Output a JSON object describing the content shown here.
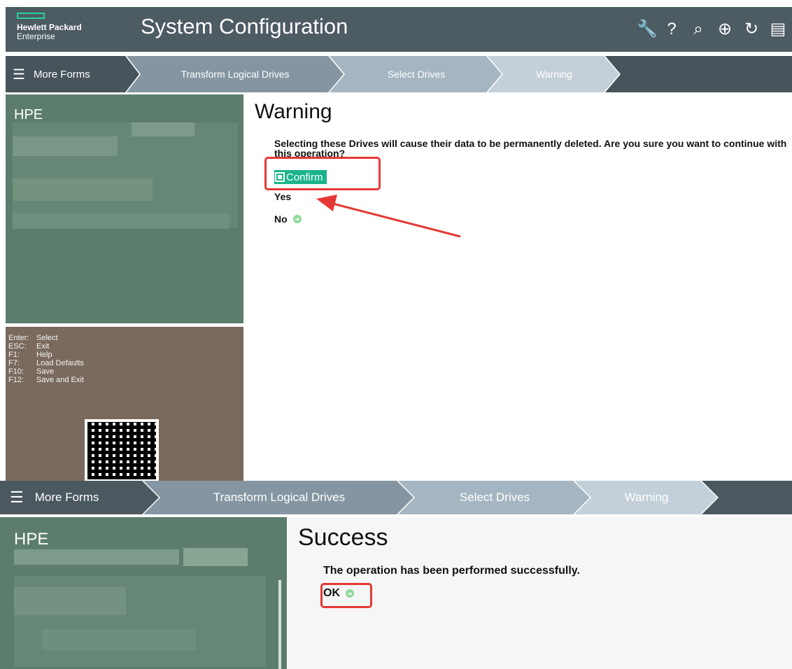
{
  "header": {
    "logo_line1": "Hewlett Packard",
    "logo_line2": "Enterprise",
    "title": "System Configuration",
    "icons": [
      "wrench-icon",
      "help-icon",
      "search-icon",
      "globe-icon",
      "refresh-icon",
      "storage-icon"
    ],
    "icon_glyphs": [
      "🔧",
      "?",
      "⌕",
      "⊕",
      "↻",
      "▤"
    ]
  },
  "breadcrumb": {
    "more_forms": "More Forms",
    "items": [
      "Transform Logical Drives",
      "Select Drives",
      "Warning"
    ]
  },
  "left_panel": {
    "brand": "HPE"
  },
  "keys": [
    {
      "key": "Enter:",
      "action": "Select"
    },
    {
      "key": "ESC:",
      "action": "Exit"
    },
    {
      "key": "F1:",
      "action": "Help"
    },
    {
      "key": "F7:",
      "action": "Load Defaults"
    },
    {
      "key": "F10:",
      "action": "Save"
    },
    {
      "key": "F12:",
      "action": "Save and Exit"
    }
  ],
  "warning_form": {
    "title": "Warning",
    "message": "Selecting these Drives will cause their data to be permanently deleted. Are you sure you want to continue with this operation?",
    "confirm_label": "Confirm",
    "yes_label": "Yes",
    "no_label": "No"
  },
  "success_form": {
    "title": "Success",
    "message": "The operation has been performed successfully.",
    "ok_label": "OK"
  },
  "colors": {
    "header_bg": "#4d5b63",
    "accent_green": "#1bb48a",
    "left_panel": "#5c7d6d",
    "keys_panel": "#7a6a5d",
    "highlight_red": "#e53935"
  }
}
